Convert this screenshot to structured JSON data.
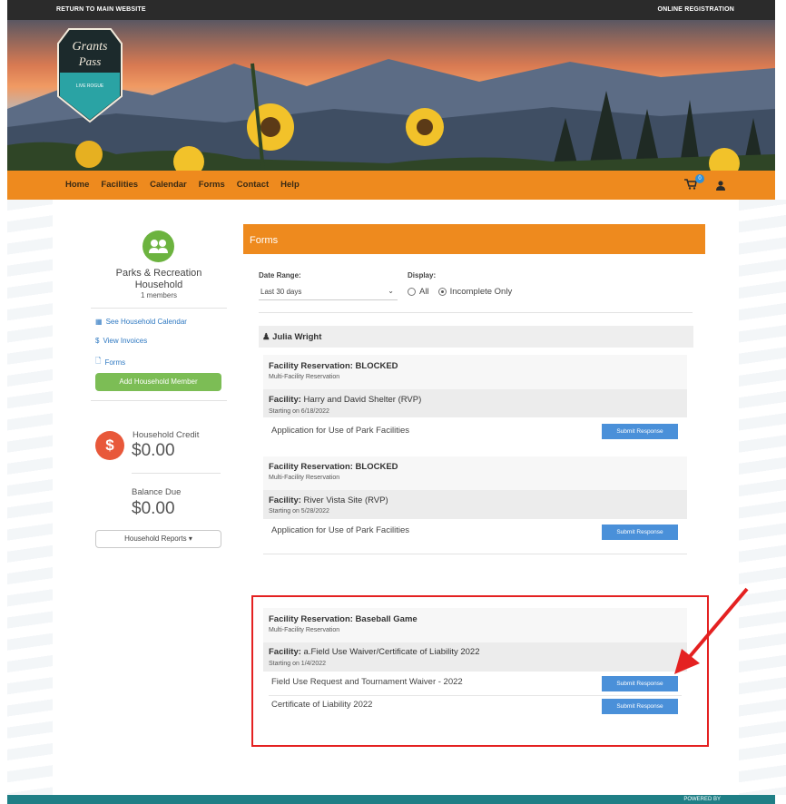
{
  "topbar": {
    "left_link": "RETURN TO MAIN WEBSITE",
    "right_link": "ONLINE REGISTRATION"
  },
  "logo": {
    "line1": "Grants",
    "line2": "Pass",
    "tagline": "LIVE ROGUE"
  },
  "nav": {
    "items": [
      "Home",
      "Facilities",
      "Calendar",
      "Forms",
      "Contact",
      "Help"
    ],
    "cart_count": "0",
    "icons": {
      "cart": "cart-icon",
      "user": "user-icon"
    }
  },
  "sidebar": {
    "title": "Parks & Recreation Household",
    "members": "1 members",
    "links": {
      "calendar": "See Household Calendar",
      "invoices": "View Invoices",
      "forms": "Forms"
    },
    "add_member": "Add Household Member",
    "credit_label": "Household Credit",
    "credit_amount": "$0.00",
    "balance_label": "Balance Due",
    "balance_amount": "$0.00",
    "reports": "Household Reports ▾"
  },
  "main": {
    "header": "Forms",
    "date_range_label": "Date Range:",
    "date_range_value": "Last 30 days",
    "display_label": "Display:",
    "display_all": "All",
    "display_incomplete": "Incomplete Only",
    "person": "Julia Wright",
    "sections": [
      {
        "title": "Facility Reservation: BLOCKED",
        "subtitle": "Multi-Facility Reservation",
        "facility_prefix": "Facility:",
        "facility": "Harry and David Shelter (RVP)",
        "starting": "Starting on 6/18/2022",
        "forms": [
          "Application for Use of Park Facilities"
        ]
      },
      {
        "title": "Facility Reservation: BLOCKED",
        "subtitle": "Multi-Facility Reservation",
        "facility_prefix": "Facility:",
        "facility": "River Vista Site (RVP)",
        "starting": "Starting on 5/28/2022",
        "forms": [
          "Application for Use of Park Facilities"
        ]
      },
      {
        "title": "Facility Reservation: Baseball Game",
        "subtitle": "Multi-Facility Reservation",
        "facility_prefix": "Facility:",
        "facility": "a.Field Use Waiver/Certificate of Liability 2022",
        "starting": "Starting on 1/4/2022",
        "forms": [
          "Field Use Request and Tournament Waiver - 2022",
          "Certificate of Liability 2022"
        ]
      }
    ],
    "submit_label": "Submit Response"
  },
  "footer": {
    "text": "POWERED BY"
  },
  "colors": {
    "accent": "#ee8a1e",
    "button": "#4a90d9",
    "highlight": "#e42121",
    "green": "#7cbd55"
  }
}
